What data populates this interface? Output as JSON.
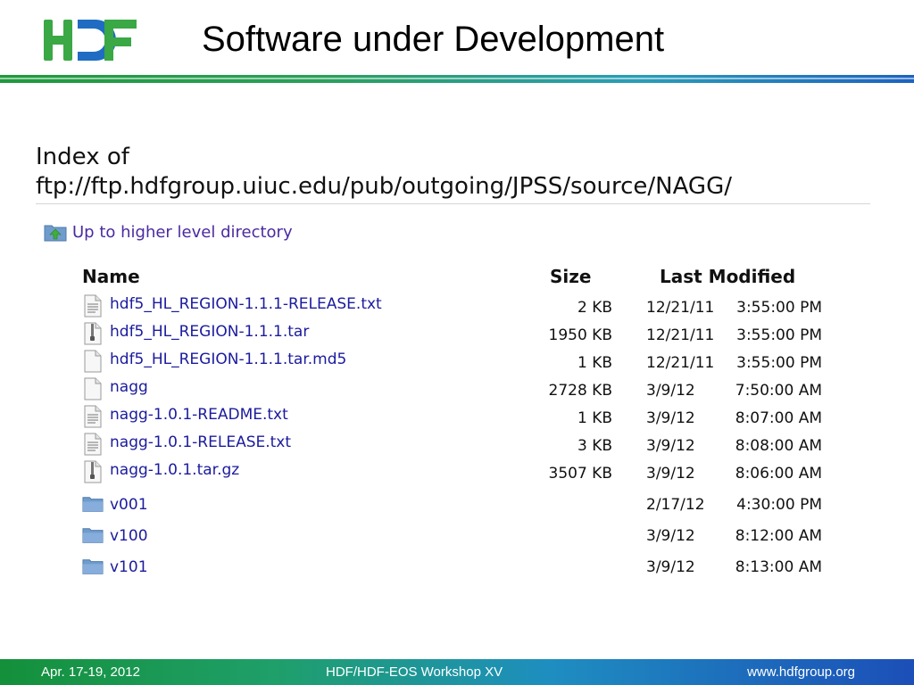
{
  "slide": {
    "title": "Software under Development",
    "logo_text": "HDF"
  },
  "listing": {
    "index_title": "Index of ftp://ftp.hdfgroup.uiuc.edu/pub/outgoing/JPSS/source/NAGG/",
    "up_link": "Up to higher level directory",
    "columns": {
      "name": "Name",
      "size": "Size",
      "last_modified": "Last Modified"
    },
    "rows": [
      {
        "icon": "text-file-icon",
        "name": "hdf5_HL_REGION-1.1.1-RELEASE.txt",
        "size": "2 KB",
        "date": "12/21/11",
        "time": "3:55:00 PM"
      },
      {
        "icon": "archive-file-icon",
        "name": "hdf5_HL_REGION-1.1.1.tar",
        "size": "1950 KB",
        "date": "12/21/11",
        "time": "3:55:00 PM"
      },
      {
        "icon": "blank-file-icon",
        "name": "hdf5_HL_REGION-1.1.1.tar.md5",
        "size": "1 KB",
        "date": "12/21/11",
        "time": "3:55:00 PM"
      },
      {
        "icon": "blank-file-icon",
        "name": "nagg",
        "size": "2728 KB",
        "date": "3/9/12",
        "time": "7:50:00 AM"
      },
      {
        "icon": "text-file-icon",
        "name": "nagg-1.0.1-README.txt",
        "size": "1 KB",
        "date": "3/9/12",
        "time": "8:07:00 AM"
      },
      {
        "icon": "text-file-icon",
        "name": "nagg-1.0.1-RELEASE.txt",
        "size": "3 KB",
        "date": "3/9/12",
        "time": "8:08:00 AM"
      },
      {
        "icon": "archive-file-icon",
        "name": "nagg-1.0.1.tar.gz",
        "size": "3507 KB",
        "date": "3/9/12",
        "time": "8:06:00 AM"
      },
      {
        "icon": "folder-icon",
        "name": "v001",
        "size": "",
        "date": "2/17/12",
        "time": "4:30:00 PM"
      },
      {
        "icon": "folder-icon",
        "name": "v100",
        "size": "",
        "date": "3/9/12",
        "time": "8:12:00 AM"
      },
      {
        "icon": "folder-icon",
        "name": "v101",
        "size": "",
        "date": "3/9/12",
        "time": "8:13:00 AM"
      }
    ]
  },
  "footer": {
    "date": "Apr. 17-19, 2012",
    "event": "HDF/HDF-EOS Workshop XV",
    "url": "www.hdfgroup.org"
  },
  "colors": {
    "logo_green": "#3aa845",
    "logo_blue": "#1f6cc2",
    "link_blue": "#1b1b9e",
    "link_purple": "#4b2aa0",
    "folder_blue": "#6f9ccc"
  }
}
